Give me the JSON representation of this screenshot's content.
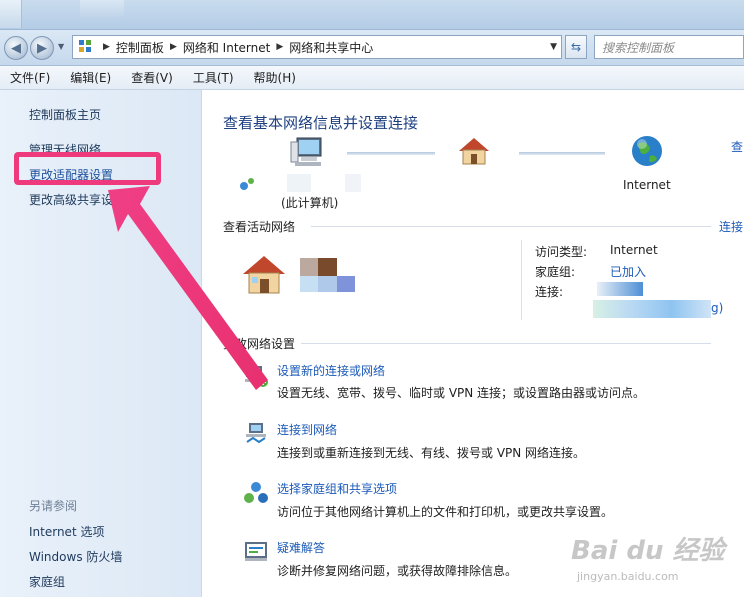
{
  "address_bar": {
    "crumbs": [
      "控制面板",
      "网络和 Internet",
      "网络和共享中心"
    ],
    "search_placeholder": "搜索控制面板"
  },
  "menu": [
    "文件(F)",
    "编辑(E)",
    "查看(V)",
    "工具(T)",
    "帮助(H)"
  ],
  "sidebar": {
    "links": [
      "控制面板主页",
      "管理无线网络",
      "更改适配器设置",
      "更改高级共享设"
    ],
    "active_index": 2,
    "see_also_title": "另请参阅",
    "see_also": [
      "Internet 选项",
      "Windows 防火墙",
      "家庭组"
    ]
  },
  "main": {
    "title": "查看基本网络信息并设置连接",
    "top_right_link": "查",
    "network_map": {
      "computer_label": "(此计算机)",
      "internet_label": "Internet"
    },
    "active_networks": {
      "title": "查看活动网络",
      "right_link": "连接",
      "access_type_label": "访问类型:",
      "access_type_value": "Internet",
      "homegroup_label": "家庭组:",
      "homegroup_value": "已加入",
      "connection_label": "连接:",
      "connection_suffix": "g)"
    },
    "change_settings": {
      "title": "更改网络设置",
      "tasks": [
        {
          "link": "设置新的连接或网络",
          "desc": "设置无线、宽带、拨号、临时或 VPN 连接；或设置路由器或访问点。"
        },
        {
          "link": "连接到网络",
          "desc": "连接到或重新连接到无线、有线、拨号或 VPN 网络连接。"
        },
        {
          "link": "选择家庭组和共享选项",
          "desc": "访问位于其他网络计算机上的文件和打印机，或更改共享设置。"
        },
        {
          "link": "疑难解答",
          "desc": "诊断并修复网络问题，或获得故障排除信息。"
        }
      ]
    }
  },
  "watermark": {
    "text": "Bai du 经验",
    "sub": "jingyan.baidu.com"
  },
  "colors": {
    "highlight": "#ee3a7d",
    "link": "#1c5bb8",
    "title": "#1e3f80"
  }
}
